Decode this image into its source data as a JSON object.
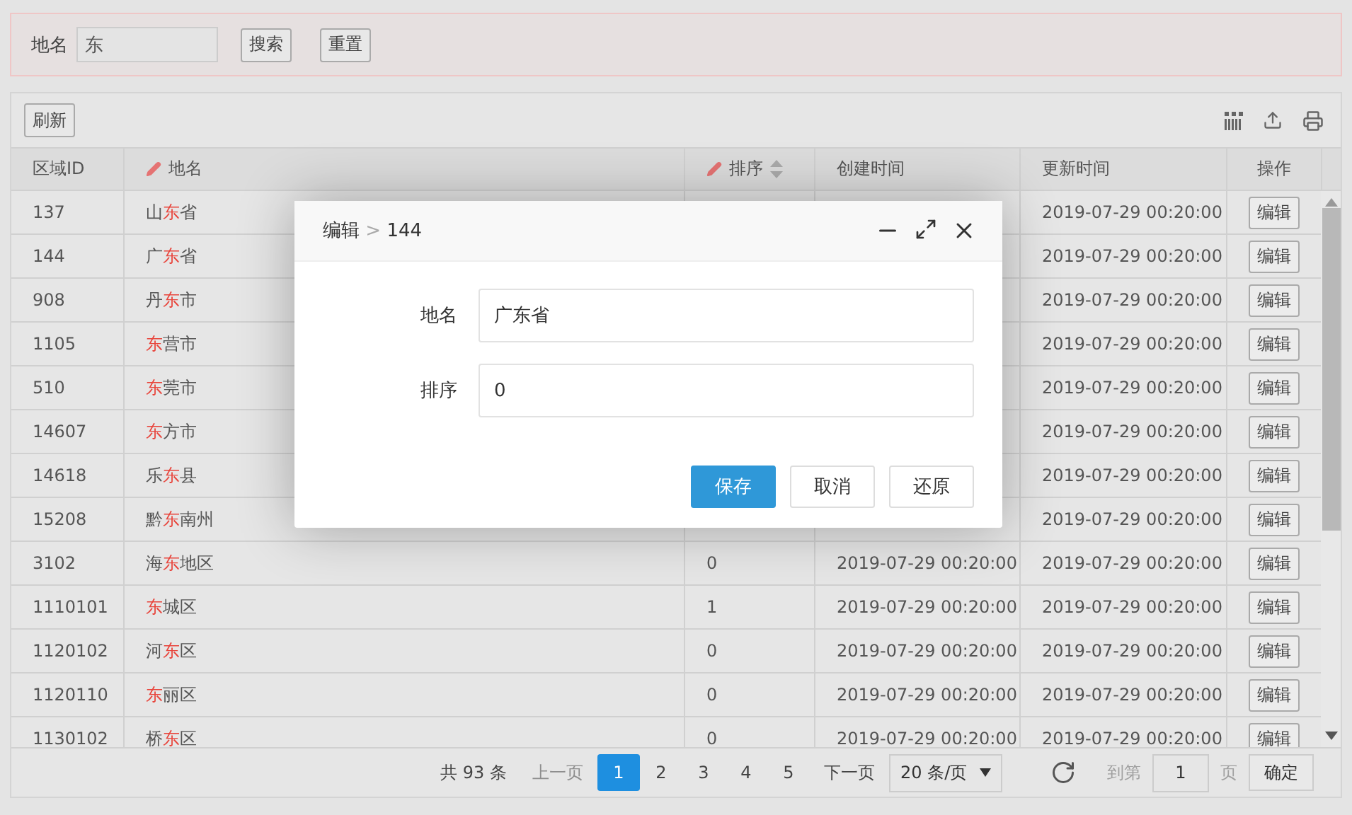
{
  "search": {
    "label": "地名",
    "value": "东",
    "buttons": [
      "搜索",
      "重置"
    ]
  },
  "toolbar": {
    "buttons": [
      "刷新"
    ]
  },
  "table": {
    "columns": [
      {
        "label": "区域ID",
        "editable": false,
        "sortable": false
      },
      {
        "label": "地名",
        "editable": true,
        "sortable": false
      },
      {
        "label": "排序",
        "editable": true,
        "sortable": true
      },
      {
        "label": "创建时间",
        "editable": false,
        "sortable": false
      },
      {
        "label": "更新时间",
        "editable": false,
        "sortable": false
      },
      {
        "label": "操作",
        "editable": false,
        "sortable": false
      }
    ],
    "rows": [
      {
        "id": "137",
        "name": [
          {
            "text": "山",
            "match": false
          },
          {
            "text": "东",
            "match": true
          },
          {
            "text": "省",
            "match": false
          }
        ],
        "updated": "2019-07-29 00:20:00",
        "action": "编辑"
      },
      {
        "id": "144",
        "name": [
          {
            "text": "广",
            "match": false
          },
          {
            "text": "东",
            "match": true
          },
          {
            "text": "省",
            "match": false
          }
        ],
        "updated": "2019-07-29 00:20:00",
        "action": "编辑"
      },
      {
        "id": "908",
        "name": [
          {
            "text": "丹",
            "match": false
          },
          {
            "text": "东",
            "match": true
          },
          {
            "text": "市",
            "match": false
          }
        ],
        "updated": "2019-07-29 00:20:00",
        "action": "编辑"
      },
      {
        "id": "1105",
        "name": [
          {
            "text": "东",
            "match": true
          },
          {
            "text": "营市",
            "match": false
          }
        ],
        "updated": "2019-07-29 00:20:00",
        "action": "编辑"
      },
      {
        "id": "510",
        "name": [
          {
            "text": "东",
            "match": true
          },
          {
            "text": "莞市",
            "match": false
          }
        ],
        "updated": "2019-07-29 00:20:00",
        "action": "编辑"
      },
      {
        "id": "14607",
        "name": [
          {
            "text": "东",
            "match": true
          },
          {
            "text": "方市",
            "match": false
          }
        ],
        "updated": "2019-07-29 00:20:00",
        "action": "编辑"
      },
      {
        "id": "14618",
        "name": [
          {
            "text": "乐",
            "match": false
          },
          {
            "text": "东",
            "match": true
          },
          {
            "text": "县",
            "match": false
          }
        ],
        "updated": "2019-07-29 00:20:00",
        "action": "编辑"
      },
      {
        "id": "15208",
        "name": [
          {
            "text": "黔",
            "match": false
          },
          {
            "text": "东",
            "match": true
          },
          {
            "text": "南州",
            "match": false
          }
        ],
        "updated": "2019-07-29 00:20:00",
        "action": "编辑"
      },
      {
        "id": "3102",
        "name": [
          {
            "text": "海",
            "match": false
          },
          {
            "text": "东",
            "match": true
          },
          {
            "text": "地区",
            "match": false
          }
        ],
        "sort": "0",
        "created": "2019-07-29 00:20:00",
        "updated": "2019-07-29 00:20:00",
        "action": "编辑"
      },
      {
        "id": "1110101",
        "name": [
          {
            "text": "东",
            "match": true
          },
          {
            "text": "城区",
            "match": false
          }
        ],
        "sort": "1",
        "created": "2019-07-29 00:20:00",
        "updated": "2019-07-29 00:20:00",
        "action": "编辑"
      },
      {
        "id": "1120102",
        "name": [
          {
            "text": "河",
            "match": false
          },
          {
            "text": "东",
            "match": true
          },
          {
            "text": "区",
            "match": false
          }
        ],
        "sort": "0",
        "created": "2019-07-29 00:20:00",
        "updated": "2019-07-29 00:20:00",
        "action": "编辑"
      },
      {
        "id": "1120110",
        "name": [
          {
            "text": "东",
            "match": true
          },
          {
            "text": "丽区",
            "match": false
          }
        ],
        "sort": "0",
        "created": "2019-07-29 00:20:00",
        "updated": "2019-07-29 00:20:00",
        "action": "编辑"
      },
      {
        "id": "1130102",
        "name": [
          {
            "text": "桥",
            "match": false
          },
          {
            "text": "东",
            "match": true
          },
          {
            "text": "区",
            "match": false
          }
        ],
        "sort": "0",
        "created": "2019-07-29 00:20:00",
        "updated": "2019-07-29 00:20:00",
        "action": "编辑"
      }
    ]
  },
  "pager": {
    "total": "共 93 条",
    "prev": {
      "label": "上一页",
      "disabled": true
    },
    "pages": [
      {
        "label": "1",
        "selected": true
      },
      {
        "label": "2",
        "selected": false
      },
      {
        "label": "3",
        "selected": false
      },
      {
        "label": "4",
        "selected": false
      },
      {
        "label": "5",
        "selected": false
      }
    ],
    "next": {
      "label": "下一页",
      "disabled": false
    },
    "page_size": "20 条/页",
    "goto_label": "到第",
    "goto_value": "1",
    "page_unit": "页",
    "confirm": "确定"
  },
  "dialog": {
    "title": "编辑",
    "separator": ">",
    "record": "144",
    "fields": [
      {
        "label": "地名",
        "value": "广东省"
      },
      {
        "label": "排序",
        "value": "0"
      }
    ],
    "buttons": [
      {
        "label": "保存",
        "kind": "primary"
      },
      {
        "label": "取消",
        "kind": "default"
      },
      {
        "label": "还原",
        "kind": "default"
      }
    ]
  }
}
